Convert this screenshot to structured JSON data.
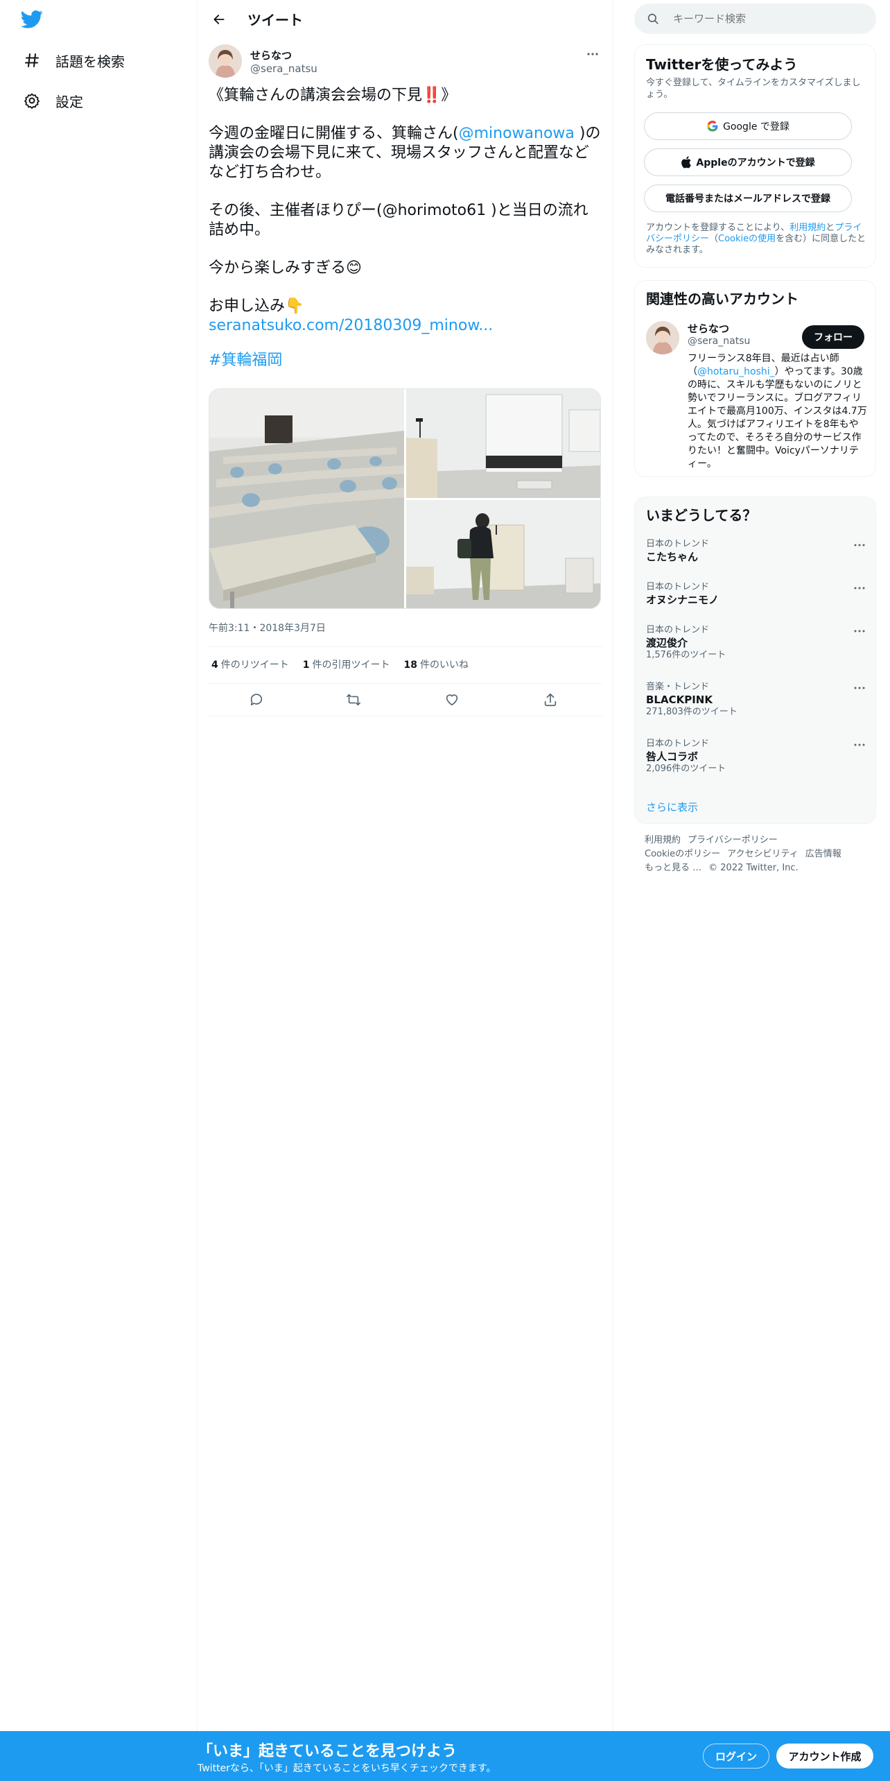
{
  "nav": {
    "items": [
      {
        "label": "話題を検索",
        "icon": "hashtag-icon"
      },
      {
        "label": "設定",
        "icon": "gear-icon"
      }
    ]
  },
  "header": {
    "title": "ツイート"
  },
  "tweet": {
    "author_name": "せらなつ",
    "author_handle": "@sera_natsu",
    "title_line": "《箕輪さんの講演会会場の下見‼️》",
    "p1_a": "今週の金曜日に開催する、箕輪さん(",
    "p1_mention": "@minowanowa",
    "p1_b": " )の講演会の会場下見に来て、現場スタッフさんと配置などなど打ち合わせ。",
    "p2": "その後、主催者ほりぴー(@horimoto61 )と当日の流れ詰め中。",
    "p3": "今から楽しみすぎる😊",
    "p4": "お申し込み👇",
    "link": "seranatsuko.com/20180309_minow...",
    "hashtag": "#箕輪福岡",
    "timestamp": "午前3:11・2018年3月7日",
    "stats": {
      "retweets_count": "4",
      "retweets_label": "件のリツイート",
      "quotes_count": "1",
      "quotes_label": "件の引用ツイート",
      "likes_count": "18",
      "likes_label": "件のいいね"
    }
  },
  "search": {
    "placeholder": "キーワード検索"
  },
  "signup": {
    "title": "Twitterを使ってみよう",
    "subtitle": "今すぐ登録して、タイムラインをカスタマイズしましょう。",
    "google_label": "Google で登録",
    "apple_label": "Appleのアカウントで登録",
    "phone_label": "電話番号またはメールアドレスで登録",
    "terms_a": "アカウントを登録することにより、",
    "terms_link1": "利用規約",
    "terms_b": "と",
    "terms_link2": "プライバシーポリシー",
    "terms_c": "（",
    "terms_link3": "Cookieの使用",
    "terms_d": "を含む）に同意したとみなされます。"
  },
  "related": {
    "title": "関連性の高いアカウント",
    "name": "せらなつ",
    "handle": "@sera_natsu",
    "follow_label": "フォロー",
    "bio_a": "フリーランス8年目、最近は占い師（",
    "bio_mention": "@hotaru_hoshi_",
    "bio_b": "）やってます。30歳の時に、スキルも学歴もないのにノリと勢いでフリーランスに。ブログアフィリエイトで最高月100万、インスタは4.7万人。気づけばアフィリエイトを8年もやってたので、そろそろ自分のサービス作りたい！と奮闘中。Voicyパーソナリティー。"
  },
  "trends": {
    "title": "いまどうしてる？",
    "items": [
      {
        "meta": "日本のトレンド",
        "name": "こたちゃん",
        "count": ""
      },
      {
        "meta": "日本のトレンド",
        "name": "オヌシナニモノ",
        "count": ""
      },
      {
        "meta": "日本のトレンド",
        "name": "渡辺俊介",
        "count": "1,576件のツイート"
      },
      {
        "meta": "音楽・トレンド",
        "name": "BLACKPINK",
        "count": "271,803件のツイート"
      },
      {
        "meta": "日本のトレンド",
        "name": "咎人コラボ",
        "count": "2,096件のツイート"
      }
    ],
    "show_more": "さらに表示"
  },
  "footer": {
    "links": [
      "利用規約",
      "プライバシーポリシー",
      "Cookieのポリシー",
      "アクセシビリティ",
      "広告情報",
      "もっと見る …"
    ],
    "copyright": "© 2022 Twitter, Inc."
  },
  "bottombar": {
    "title": "「いま」起きていることを見つけよう",
    "subtitle": "Twitterなら、「いま」起きていることをいち早くチェックできます。",
    "login_label": "ログイン",
    "signup_label": "アカウント作成"
  },
  "colors": {
    "accent": "#1d9bf0",
    "text": "#0f1419",
    "secondary": "#536471"
  }
}
